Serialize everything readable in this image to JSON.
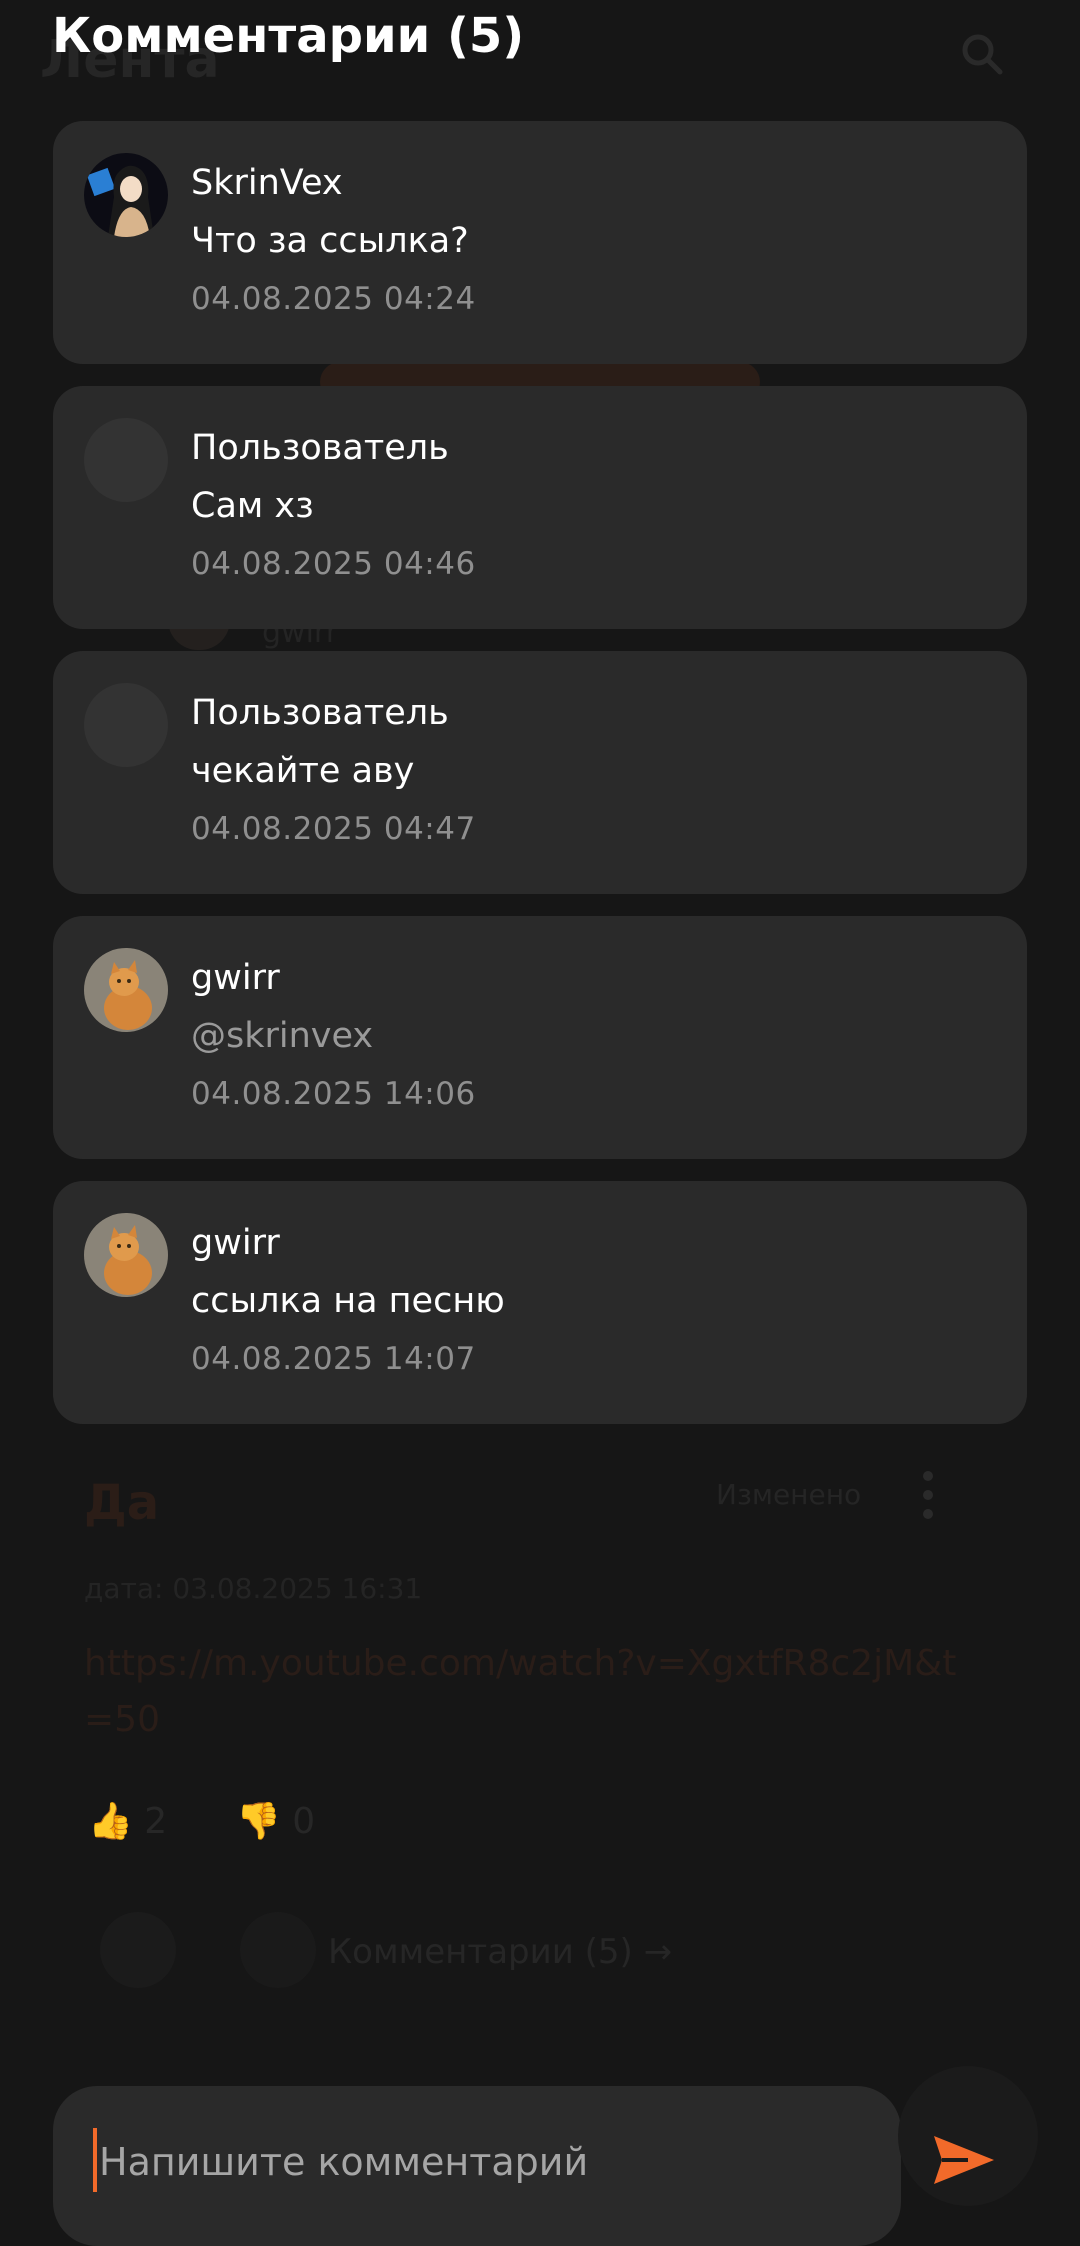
{
  "background": {
    "title": "Лента",
    "author": "gwirr",
    "post_title": "Да",
    "edited_label": "Изменено",
    "date_label": "дата: 03.08.2025 16:31",
    "link": "https://m.youtube.com/watch?v=XgxtfR8c2jM&t=50",
    "likes": "2",
    "dislikes": "0",
    "comments_link": "Комментарии (5) →"
  },
  "header": {
    "title": "Комментарии (5)"
  },
  "comments": [
    {
      "author": "SkrinVex",
      "text": "Что за ссылка?",
      "date": "04.08.2025 04:24",
      "avatar": "anime-avatar"
    },
    {
      "author": "Пользователь",
      "text": "Сам хз",
      "date": "04.08.2025 04:46",
      "avatar": "empty"
    },
    {
      "author": "Пользователь",
      "text": "чекайте аву",
      "date": "04.08.2025 04:47",
      "avatar": "empty"
    },
    {
      "author": "gwirr",
      "text": "@skrinvex",
      "date": "04.08.2025 14:06",
      "avatar": "cat-avatar"
    },
    {
      "author": "gwirr",
      "text": "ссылка на песню",
      "date": "04.08.2025 14:07",
      "avatar": "cat-avatar"
    }
  ],
  "composer": {
    "placeholder": "Напишите комментарий",
    "send_icon": "send-icon"
  },
  "colors": {
    "accent": "#f26a2a",
    "card": "#2a2a2a",
    "background": "#161616"
  }
}
